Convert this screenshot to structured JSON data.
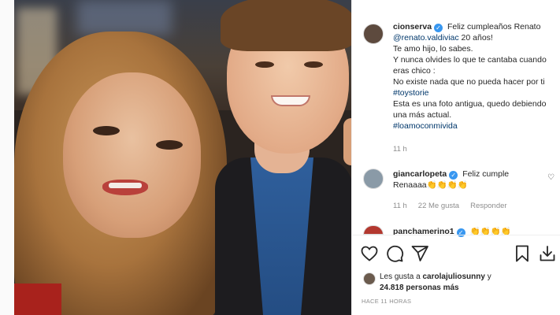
{
  "post": {
    "author": "cionserva",
    "caption_line1": "Feliz cumpleaños Renato",
    "mention": "@renato.valdiviac",
    "caption_after_mention": " 20 años!",
    "caption_line2": "Te amo hijo, lo sabes.",
    "caption_line3": "Y nunca olvides lo que te cantaba cuando eras chico :",
    "caption_line4": "No existe nada que no pueda hacer por ti",
    "hashtag1": "#toystorie",
    "caption_line5": "Esta es una foto antigua, quedo debiendo una más actual.",
    "hashtag2": "#loamoconmivida",
    "time": "11 h"
  },
  "comments": [
    {
      "user": "giancarlopeta",
      "text": "Feliz cumple Renaaaa",
      "emoji": "👏👏👏👏",
      "time": "11 h",
      "likes": "22 Me gusta",
      "reply": "Responder"
    },
    {
      "user": "panchamerino1",
      "emoji": "👏👏👏👏"
    }
  ],
  "likes": {
    "prefix": "Les gusta a ",
    "user": "carolajuliosunny",
    "middle": " y",
    "count": "24.818 personas más"
  },
  "timestamp": "HACE 11 HORAS",
  "icons": {
    "like": "heart-icon",
    "comment": "comment-icon",
    "share": "share-icon",
    "save": "bookmark-icon",
    "download": "download-icon"
  },
  "colors": {
    "verified": "#3897f0",
    "link": "#00376b",
    "meta": "#8e8e8e"
  }
}
